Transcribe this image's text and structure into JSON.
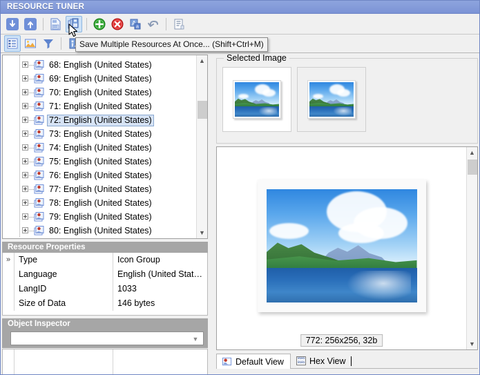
{
  "window": {
    "title": "RESOURCE TUNER"
  },
  "toolbar_main": {
    "buttons": [
      {
        "name": "move-down-button",
        "icon": "arrow-down-icon",
        "label": "Move Down"
      },
      {
        "name": "move-up-button",
        "icon": "arrow-up-icon",
        "label": "Move Up"
      },
      {
        "name": "save-resource-button",
        "icon": "save-single-icon",
        "label": "Save Resource..."
      },
      {
        "name": "save-multiple-resources-button",
        "icon": "save-multiple-icon",
        "label": "Save Multiple Resources At Once..."
      },
      {
        "name": "add-resource-button",
        "icon": "plus-circle-green-icon",
        "label": "Add Resource"
      },
      {
        "name": "delete-resource-button",
        "icon": "cross-circle-red-icon",
        "label": "Delete Resource"
      },
      {
        "name": "change-language-button",
        "icon": "language-icon",
        "label": "Change Language"
      },
      {
        "name": "undo-button",
        "icon": "undo-arrow-icon",
        "label": "Undo"
      },
      {
        "name": "report-button",
        "icon": "report-list-icon",
        "label": "Report"
      }
    ]
  },
  "toolbar_view": {
    "buttons": [
      {
        "name": "tree-view-button",
        "icon": "tree-list-icon",
        "label": "Tree View",
        "active": true
      },
      {
        "name": "image-view-button",
        "icon": "picture-icon",
        "label": "Image View",
        "active": false
      },
      {
        "name": "filter-button",
        "icon": "funnel-icon",
        "label": "Filter",
        "active": false
      },
      {
        "name": "properties-button",
        "icon": "info-column-icon",
        "label": "Properties",
        "active": false
      }
    ]
  },
  "tooltip": {
    "text": "Save Multiple Resources At Once... (Shift+Ctrl+M)"
  },
  "tree": {
    "items": [
      {
        "label": "68: English (United States)",
        "selected": false
      },
      {
        "label": "69: English (United States)",
        "selected": false
      },
      {
        "label": "70: English (United States)",
        "selected": false
      },
      {
        "label": "71: English (United States)",
        "selected": false
      },
      {
        "label": "72: English (United States)",
        "selected": true
      },
      {
        "label": "73: English (United States)",
        "selected": false
      },
      {
        "label": "74: English (United States)",
        "selected": false
      },
      {
        "label": "75: English (United States)",
        "selected": false
      },
      {
        "label": "76: English (United States)",
        "selected": false
      },
      {
        "label": "77: English (United States)",
        "selected": false
      },
      {
        "label": "78: English (United States)",
        "selected": false
      },
      {
        "label": "79: English (United States)",
        "selected": false
      },
      {
        "label": "80: English (United States)",
        "selected": false
      }
    ]
  },
  "resource_properties": {
    "header": "Resource Properties",
    "rows": [
      {
        "marker": "»",
        "name": "Type",
        "value": "Icon Group"
      },
      {
        "marker": "",
        "name": "Language",
        "value": "English (United Stat…"
      },
      {
        "marker": "",
        "name": "LangID",
        "value": "1033"
      },
      {
        "marker": "",
        "name": "Size of Data",
        "value": "146 bytes"
      }
    ]
  },
  "object_inspector": {
    "header": "Object Inspector",
    "combo_value": "",
    "combo_placeholder": ""
  },
  "selected_image": {
    "title": "Selected Image",
    "thumbnails": [
      {
        "name": "thumbnail-1",
        "selected": true
      },
      {
        "name": "thumbnail-2",
        "selected": false
      }
    ]
  },
  "preview": {
    "size_label": "772: 256x256, 32b"
  },
  "tabs": [
    {
      "name": "tab-default-view",
      "label": "Default View",
      "icon": "resource-icon",
      "active": true
    },
    {
      "name": "tab-hex-view",
      "label": "Hex View",
      "icon": "hex-binary-icon",
      "active": false
    }
  ],
  "colors": {
    "titlebar": "#7b93d6",
    "panel_header": "#a6a6a6",
    "selection": "#d6e3f5",
    "accent_green": "#2aa02a",
    "accent_red": "#dd2c2c"
  }
}
